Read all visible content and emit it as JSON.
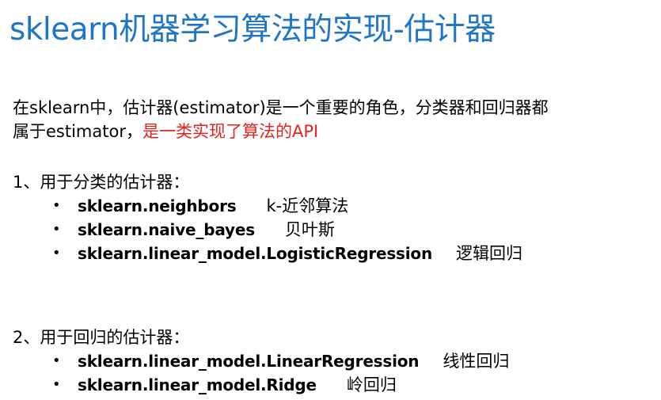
{
  "title": "sklearn机器学习算法的实现-估计器",
  "intro": {
    "line1": "在sklearn中，估计器(estimator)是一个重要的角色，分类器和回归器都",
    "line2_prefix": "属于estimator，",
    "line2_highlight": "是一类实现了算法的API"
  },
  "sections": [
    {
      "heading": "1、用于分类的估计器：",
      "items": [
        {
          "module": "sklearn.neighbors",
          "desc": "k-近邻算法"
        },
        {
          "module": "sklearn.naive_bayes",
          "desc": "贝叶斯"
        },
        {
          "module": "sklearn.linear_model.LogisticRegression",
          "desc": "逻辑回归"
        }
      ]
    },
    {
      "heading": "2、用于回归的估计器：",
      "items": [
        {
          "module": "sklearn.linear_model.LinearRegression",
          "desc": "线性回归"
        },
        {
          "module": "sklearn.linear_model.Ridge",
          "desc": "岭回归"
        }
      ]
    }
  ],
  "colors": {
    "title": "#1f76c7",
    "highlight": "#e3221e"
  }
}
